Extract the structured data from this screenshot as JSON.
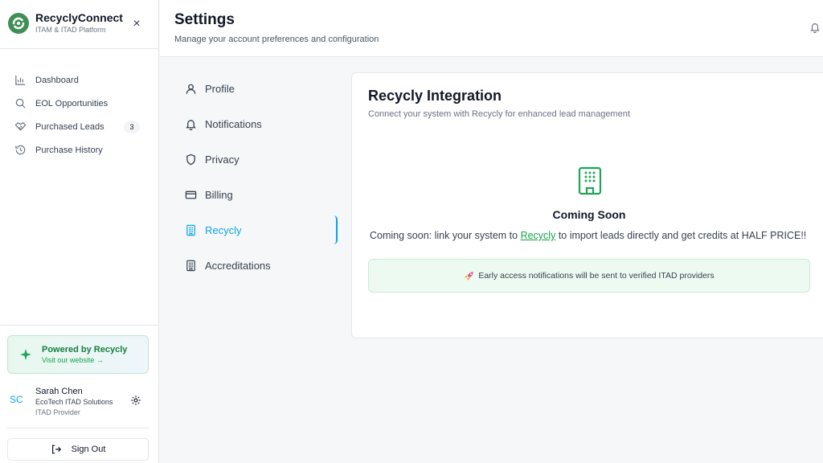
{
  "brand": {
    "title": "RecyclyConnect",
    "subtitle": "ITAM & ITAD Platform",
    "close_icon": "×",
    "accent": "#22a35a"
  },
  "sidebar": {
    "items": [
      {
        "label": "Dashboard",
        "icon": "bar-chart-icon"
      },
      {
        "label": "EOL Opportunities",
        "icon": "search-icon"
      },
      {
        "label": "Purchased Leads",
        "icon": "handshake-icon",
        "badge": "3"
      },
      {
        "label": "Purchase History",
        "icon": "history-icon"
      }
    ],
    "powered": {
      "title": "Powered by Recycly",
      "link": "Visit our website →"
    },
    "user": {
      "initials": "SC",
      "name": "Sarah Chen",
      "company": "EcoTech ITAD Solutions",
      "role": "ITAD Provider"
    },
    "signout_label": "Sign Out"
  },
  "header": {
    "title": "Settings",
    "subtitle": "Manage your account preferences and configuration"
  },
  "settings_nav": {
    "items": [
      {
        "label": "Profile"
      },
      {
        "label": "Notifications"
      },
      {
        "label": "Privacy"
      },
      {
        "label": "Billing"
      },
      {
        "label": "Recycly",
        "active": true
      },
      {
        "label": "Accreditations"
      }
    ],
    "active_color": "#0ea5e9"
  },
  "card": {
    "title": "Recycly Integration",
    "subtitle": "Connect your system with Recycly for enhanced lead management",
    "soon_title": "Coming Soon",
    "soon_prefix": "Coming soon: link your system to ",
    "soon_link": "Recycly",
    "soon_suffix": " to import leads directly and get credits at HALF PRICE!!",
    "early_access": "Early access notifications will be sent to verified ITAD providers"
  }
}
